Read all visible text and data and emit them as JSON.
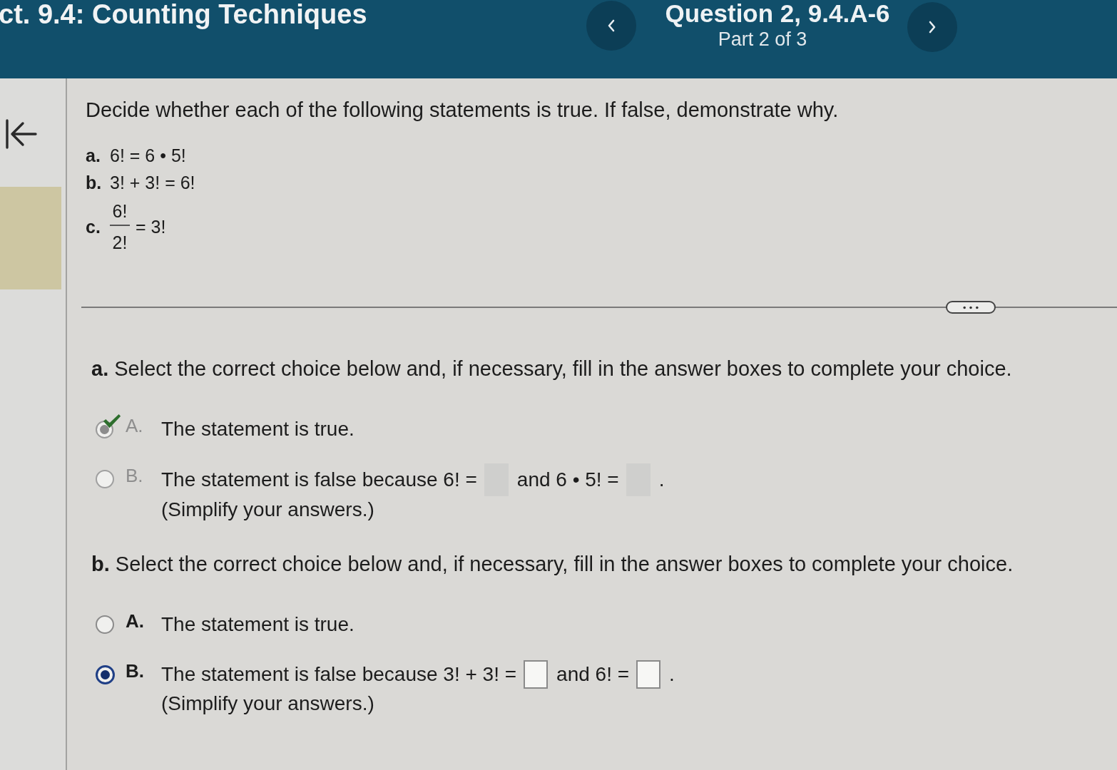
{
  "header": {
    "section_title": "ct. 9.4: Counting Techniques",
    "question": "Question 2, 9.4.A-6",
    "part": "Part 2 of 3"
  },
  "problem": {
    "instruction": "Decide whether each of the following statements is true. If false, demonstrate why.",
    "statements": [
      {
        "label": "a.",
        "kind": "inline",
        "math": "6! = 6 • 5!"
      },
      {
        "label": "b.",
        "kind": "inline",
        "math": "3! + 3! = 6!"
      },
      {
        "label": "c.",
        "kind": "fraction",
        "numerator": "6!",
        "denominator": "2!",
        "math": "= 3!"
      }
    ]
  },
  "parts": [
    {
      "prompt": "**a.** Select the correct choice below and, if necessary, fill in the answer boxes to complete your choice.",
      "disabled": true,
      "choices": [
        {
          "letter": "A.",
          "selected": true,
          "correct": true,
          "segments": [
            {
              "kind": "text",
              "text": "The statement is true."
            }
          ]
        },
        {
          "letter": "B.",
          "selected": false,
          "segments": [
            {
              "kind": "text",
              "text": "The statement is false because 6! ="
            },
            {
              "kind": "blank"
            },
            {
              "kind": "text",
              "text": "and 6 • 5! ="
            },
            {
              "kind": "blank"
            },
            {
              "kind": "text",
              "text": "."
            }
          ],
          "note": "(Simplify your answers.)"
        }
      ]
    },
    {
      "prompt": "**b.** Select the correct choice below and, if necessary, fill in the answer boxes to complete your choice.",
      "disabled": false,
      "choices": [
        {
          "letter": "A.",
          "selected": false,
          "segments": [
            {
              "kind": "text",
              "text": "The statement is true."
            }
          ]
        },
        {
          "letter": "B.",
          "selected": true,
          "segments": [
            {
              "kind": "text",
              "text": "The statement is false because 3! + 3! ="
            },
            {
              "kind": "blank"
            },
            {
              "kind": "text",
              "text": "and 6! ="
            },
            {
              "kind": "blank"
            },
            {
              "kind": "text",
              "text": "."
            }
          ],
          "note": "(Simplify your answers.)"
        }
      ]
    }
  ]
}
